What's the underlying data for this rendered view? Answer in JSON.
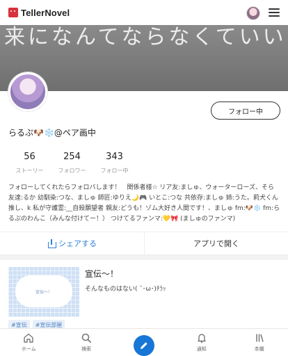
{
  "header": {
    "app_name": "TellerNovel",
    "avatar_icon": "user-avatar",
    "menu_icon": "hamburger-menu-icon"
  },
  "banner": {
    "text": "来になんてならなくていいから"
  },
  "profile": {
    "display_name": "らるぷ🐶❄️@ペア画中",
    "follow_label": "フォロー中",
    "stats": [
      {
        "value": "56",
        "label": "ストーリー"
      },
      {
        "value": "254",
        "label": "フォロワー"
      },
      {
        "value": "343",
        "label": "フォロー中"
      }
    ],
    "bio": "フォローしてくれたらフォロバします！　関係者様☆ リア友:ましゅ、ウォーターローズ、そら 友達:るか 幼馴染:つな、ましゅ 師匠:ゆりえ🌙🎮 いとこ:つな 共依存:ましゅ 姉:うた。莉犬くん推し、k 私が守護霊:__自殺願望者 親友:どうも！ゾム大好き人間です！、ましゅ fm:🐶❄️ fm:らるぷのわんこ（みんな付けてー！） つけてるファンマ:💛🎀 (ましゅのファンマ)"
  },
  "actions": {
    "share_label": "シェアする",
    "share_icon": "share-icon",
    "open_app_label": "アプリで開く"
  },
  "story": {
    "cover_text": "宣伝〜！",
    "title": "宣伝〜！",
    "description": "そんなものはない( ˘･ω･)ﾁﾗｯ",
    "tags": [
      "#宣伝",
      "#宣伝部屋"
    ]
  },
  "bottom_nav": [
    {
      "label": "ホーム",
      "icon": "home-icon"
    },
    {
      "label": "検索",
      "icon": "search-icon"
    },
    {
      "label": "",
      "icon": "pencil-icon"
    },
    {
      "label": "通知",
      "icon": "bell-icon"
    },
    {
      "label": "本棚",
      "icon": "bookshelf-icon"
    }
  ],
  "colors": {
    "accent": "#1877d6",
    "link": "#2f7fd6",
    "brand": "#d8323c"
  }
}
